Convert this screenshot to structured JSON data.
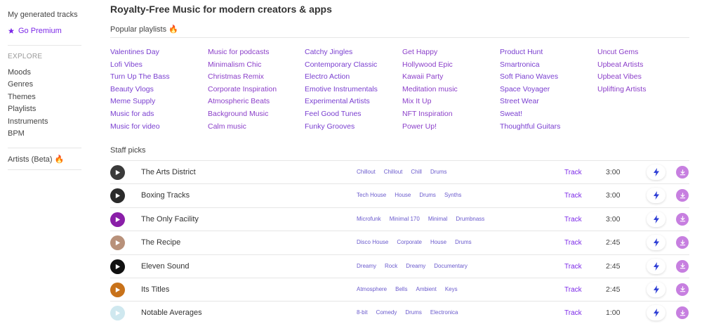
{
  "sidebar": {
    "my_tracks": "My generated tracks",
    "premium": "Go Premium",
    "explore_heading": "EXPLORE",
    "items": [
      "Moods",
      "Genres",
      "Themes",
      "Playlists",
      "Instruments",
      "BPM"
    ],
    "artists": "Artists (Beta) 🔥"
  },
  "main": {
    "title": "Royalty-Free Music for modern creators & apps",
    "popular_title": "Popular playlists 🔥",
    "staff_title": "Staff picks"
  },
  "playlists": [
    [
      "Valentines Day",
      "Lofi Vibes",
      "Turn Up The Bass",
      "Beauty Vlogs",
      "Meme Supply",
      "Music for ads",
      "Music for video"
    ],
    [
      "Music for podcasts",
      "Minimalism Chic",
      "Christmas Remix",
      "Corporate Inspiration",
      "Atmospheric Beats",
      "Background Music",
      "Calm music"
    ],
    [
      "Catchy Jingles",
      "Contemporary Classic",
      "Electro Action",
      "Emotive Instrumentals",
      "Experimental Artists",
      "Feel Good Tunes",
      "Funky Grooves"
    ],
    [
      "Get Happy",
      "Hollywood Epic",
      "Kawaii Party",
      "Meditation music",
      "Mix It Up",
      "NFT Inspiration",
      "Power Up!"
    ],
    [
      "Product Hunt",
      "Smartronica",
      "Soft Piano Waves",
      "Space Voyager",
      "Street Wear",
      "Sweat!",
      "Thoughtful Guitars"
    ],
    [
      "Uncut Gems",
      "Upbeat Artists",
      "Upbeat Vibes",
      "Uplifting Artists"
    ]
  ],
  "tracks": [
    {
      "title": "The Arts District",
      "tags": [
        "Chillout",
        "Chillout",
        "Chill",
        "Drums"
      ],
      "type": "Track",
      "duration": "3:00",
      "cover": "#3a3a3a"
    },
    {
      "title": "Boxing Tracks",
      "tags": [
        "Tech House",
        "House",
        "Drums",
        "Synths"
      ],
      "type": "Track",
      "duration": "3:00",
      "cover": "#2b2b2b"
    },
    {
      "title": "The Only Facility",
      "tags": [
        "Microfunk",
        "Minimal 170",
        "Minimal",
        "Drumbnass"
      ],
      "type": "Track",
      "duration": "3:00",
      "cover": "#8a1fa8"
    },
    {
      "title": "The Recipe",
      "tags": [
        "Disco House",
        "Corporate",
        "House",
        "Drums"
      ],
      "type": "Track",
      "duration": "2:45",
      "cover": "#b8917a"
    },
    {
      "title": "Eleven Sound",
      "tags": [
        "Dreamy",
        "Rock",
        "Dreamy",
        "Documentary"
      ],
      "type": "Track",
      "duration": "2:45",
      "cover": "#111111"
    },
    {
      "title": "Its Titles",
      "tags": [
        "Atmosphere",
        "Bells",
        "Ambient",
        "Keys"
      ],
      "type": "Track",
      "duration": "2:45",
      "cover": "#c8721a"
    },
    {
      "title": "Notable Averages",
      "tags": [
        "8-bit",
        "Comedy",
        "Drums",
        "Electronica"
      ],
      "type": "Track",
      "duration": "1:00",
      "cover": "#cfe8ef"
    }
  ],
  "colors": {
    "accent": "#7d2ae8",
    "download": "#c77fe0",
    "bolt": "#2f3fd6"
  },
  "icons": {
    "premium": "star-icon",
    "play": "play-icon",
    "bolt": "lightning-icon",
    "download": "download-icon"
  }
}
